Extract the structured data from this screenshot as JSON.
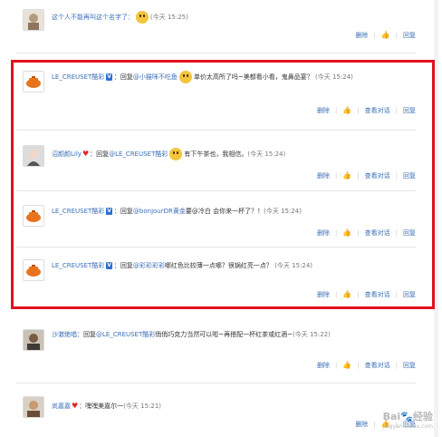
{
  "comments": [
    {
      "user": "",
      "text_a": "这个人不能再叫这个名字了：",
      "mention": "",
      "text_b": "",
      "time": "(今天 15:25)",
      "actions": [
        "删除",
        "回复"
      ]
    },
    {
      "user": "LE_CREUSET酷彩",
      "text_a": "：回复",
      "mention": "@小猫咪不吃鱼",
      "text_b": "单价太高所了吗~美都看小看，鬼鼻品宴？",
      "time": "(今天 15:24)",
      "actions": [
        "删除",
        "查看对话",
        "回复"
      ]
    },
    {
      "user": "沼颜颜Lily",
      "text_a": "：回复",
      "mention": "@LE_CREUSET酷彩",
      "text_b": "有下午茶也，我相信。",
      "time": "(今天 15:24)",
      "actions": [
        "删除",
        "查看对话",
        "回复"
      ]
    },
    {
      "user": "LE_CREUSET酷彩",
      "text_a": "：回复",
      "mention": "@bonjourDR黄金",
      "text_b": "要@冷白 会你来一杯了？！",
      "time": "(今天 15:24)",
      "actions": [
        "删除",
        "查看对话",
        "回复"
      ]
    },
    {
      "user": "LE_CREUSET酷彩",
      "text_a": "：回复",
      "mention": "@彩彩彩彩",
      "text_b": "哪红色比较薄一点哪？很锅红亮一点？",
      "time": "(今天 15:24)",
      "actions": [
        "删除",
        "查看对话",
        "回复"
      ]
    },
    {
      "user": "沙澈绝唱",
      "text_a": "：回复",
      "mention": "@LE_CREUSET酷彩",
      "text_b": "俏俏巧克力当然可以啦~再搭配一杯红茶或红酒~",
      "time": "(今天 15:22)",
      "actions": [
        "删除",
        "查看对话",
        "回复"
      ]
    },
    {
      "user": "尚嘉嘉",
      "text_a": "：嘿嘿美嘉尔一",
      "mention": "",
      "text_b": "",
      "time": "(今天 15:21)",
      "actions": [
        "删除",
        "回复"
      ]
    }
  ],
  "badges": {
    "v": "V"
  },
  "watermark": {
    "brand": "Bai",
    "paw": "🐾",
    "site": "经验",
    "url": "jingyan.baidu.com"
  },
  "icons": {
    "thumb": "thumbs-up-icon",
    "avatar": "avatar"
  },
  "colors": {
    "highlight": "#e0141e",
    "link": "#3b6fb6"
  }
}
